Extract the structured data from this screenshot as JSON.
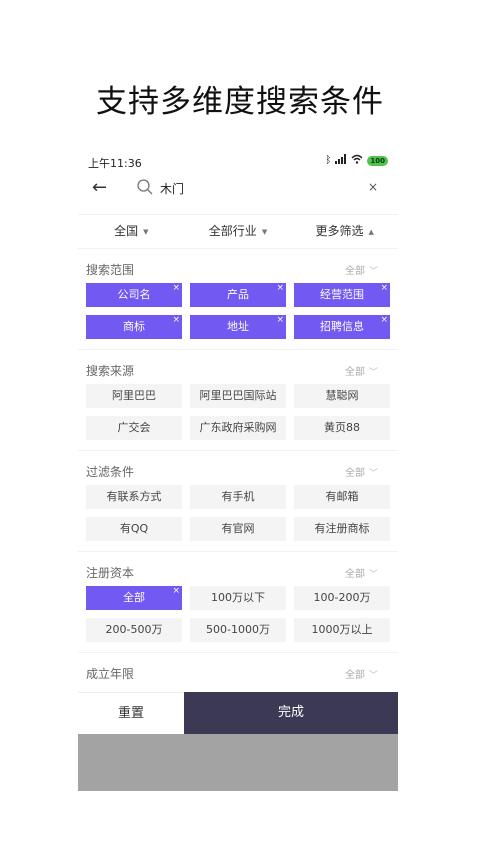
{
  "headline": "支持多维度搜索条件",
  "status": {
    "time": "上午11:36",
    "battery": "100"
  },
  "search": {
    "value": "木门",
    "clear": "×"
  },
  "filters": [
    {
      "label": "全国"
    },
    {
      "label": "全部行业"
    },
    {
      "label": "更多筛选"
    }
  ],
  "sections": [
    {
      "title": "搜索范围",
      "all": "全部",
      "chips": [
        "公司名",
        "产品",
        "经营范围",
        "商标",
        "地址",
        "招聘信息"
      ],
      "selected": [
        0,
        1,
        2,
        3,
        4,
        5
      ]
    },
    {
      "title": "搜索来源",
      "all": "全部",
      "chips": [
        "阿里巴巴",
        "阿里巴巴国际站",
        "慧聪网",
        "广交会",
        "广东政府采购网",
        "黄页88"
      ],
      "selected": []
    },
    {
      "title": "过滤条件",
      "all": "全部",
      "chips": [
        "有联系方式",
        "有手机",
        "有邮箱",
        "有QQ",
        "有官网",
        "有注册商标"
      ],
      "selected": []
    },
    {
      "title": "注册资本",
      "all": "全部",
      "chips": [
        "全部",
        "100万以下",
        "100-200万",
        "200-500万",
        "500-1000万",
        "1000万以上"
      ],
      "selected": [
        0
      ]
    },
    {
      "title": "成立年限",
      "all": "全部"
    }
  ],
  "buttons": {
    "reset": "重置",
    "done": "完成"
  },
  "colors": {
    "accent": "#7259f2",
    "done_bg": "#3b3953",
    "overlay": "#a3a3a3"
  }
}
